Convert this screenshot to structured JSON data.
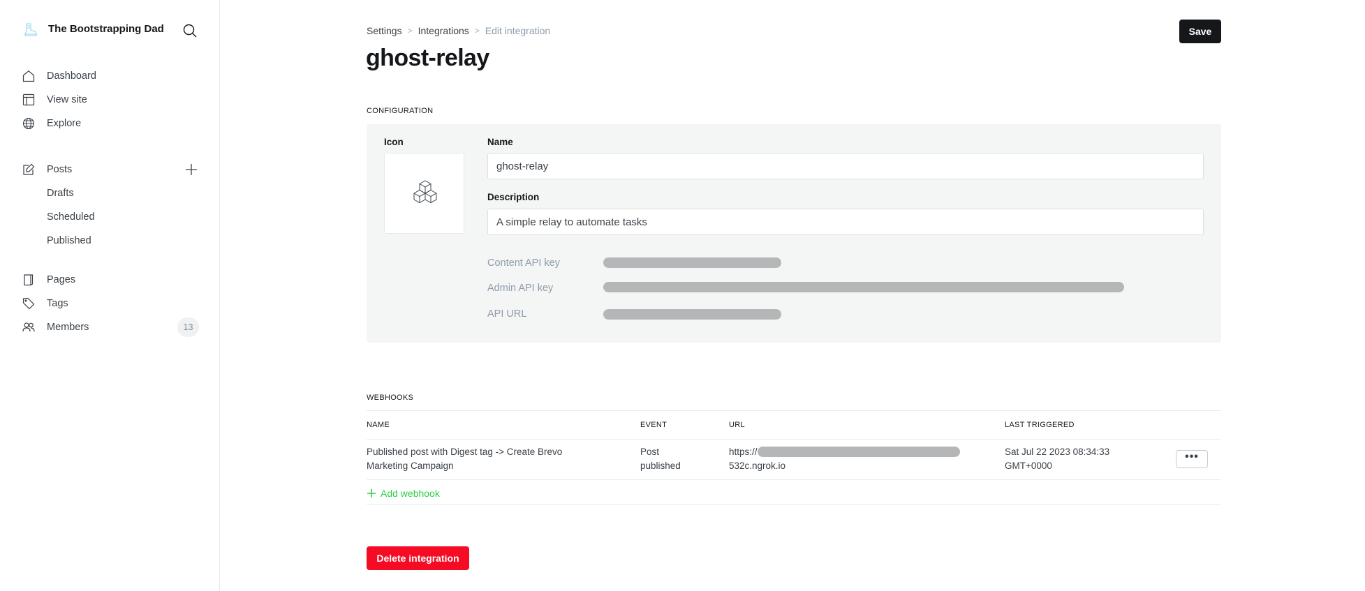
{
  "sidebar": {
    "brand_title": "The Bootstrapping Dad",
    "brand_logo_icon": "boot-icon",
    "search_icon": "search-icon",
    "items": [
      {
        "label": "Dashboard",
        "icon": "home-icon"
      },
      {
        "label": "View site",
        "icon": "layout-icon"
      },
      {
        "label": "Explore",
        "icon": "globe-icon"
      },
      {
        "label": "Posts",
        "icon": "edit-icon"
      },
      {
        "label": "Drafts"
      },
      {
        "label": "Scheduled"
      },
      {
        "label": "Published"
      },
      {
        "label": "Pages",
        "icon": "page-icon"
      },
      {
        "label": "Tags",
        "icon": "tag-icon"
      },
      {
        "label": "Members",
        "icon": "members-icon",
        "badge": "13"
      }
    ],
    "new_post_icon": "plus-icon"
  },
  "header": {
    "breadcrumb": [
      "Settings",
      "Integrations",
      "Edit integration"
    ],
    "title": "ghost-relay",
    "save_label": "Save"
  },
  "configuration": {
    "section_label": "CONFIGURATION",
    "icon_label": "Icon",
    "icon": "cubes-icon",
    "name_label": "Name",
    "name_value": "ghost-relay",
    "description_label": "Description",
    "description_value": "A simple relay to automate tasks",
    "api_fields": [
      {
        "label": "Content API key",
        "value": "[redacted]"
      },
      {
        "label": "Admin API key",
        "value": "[redacted]"
      },
      {
        "label": "API URL",
        "value": "[redacted]"
      }
    ]
  },
  "webhooks": {
    "section_label": "WEBHOOKS",
    "columns": [
      "NAME",
      "EVENT",
      "URL",
      "LAST TRIGGERED"
    ],
    "rows": [
      {
        "name_line1": "Published post with Digest tag -> Create Brevo",
        "name_line2": "Marketing Campaign",
        "event_line1": "Post",
        "event_line2": "published",
        "url_prefix": "https://",
        "url_suffix": "532c.ngrok.io",
        "last_triggered_line1": "Sat Jul 22 2023 08:34:33",
        "last_triggered_line2": "GMT+0000",
        "actions_label": "•••"
      }
    ],
    "add_label": "Add webhook"
  },
  "footer": {
    "delete_label": "Delete integration"
  },
  "colors": {
    "accent_green": "#30cf43",
    "danger_red": "#f50b23",
    "primary_dark": "#15171a",
    "panel_bg": "#f4f5f5"
  }
}
